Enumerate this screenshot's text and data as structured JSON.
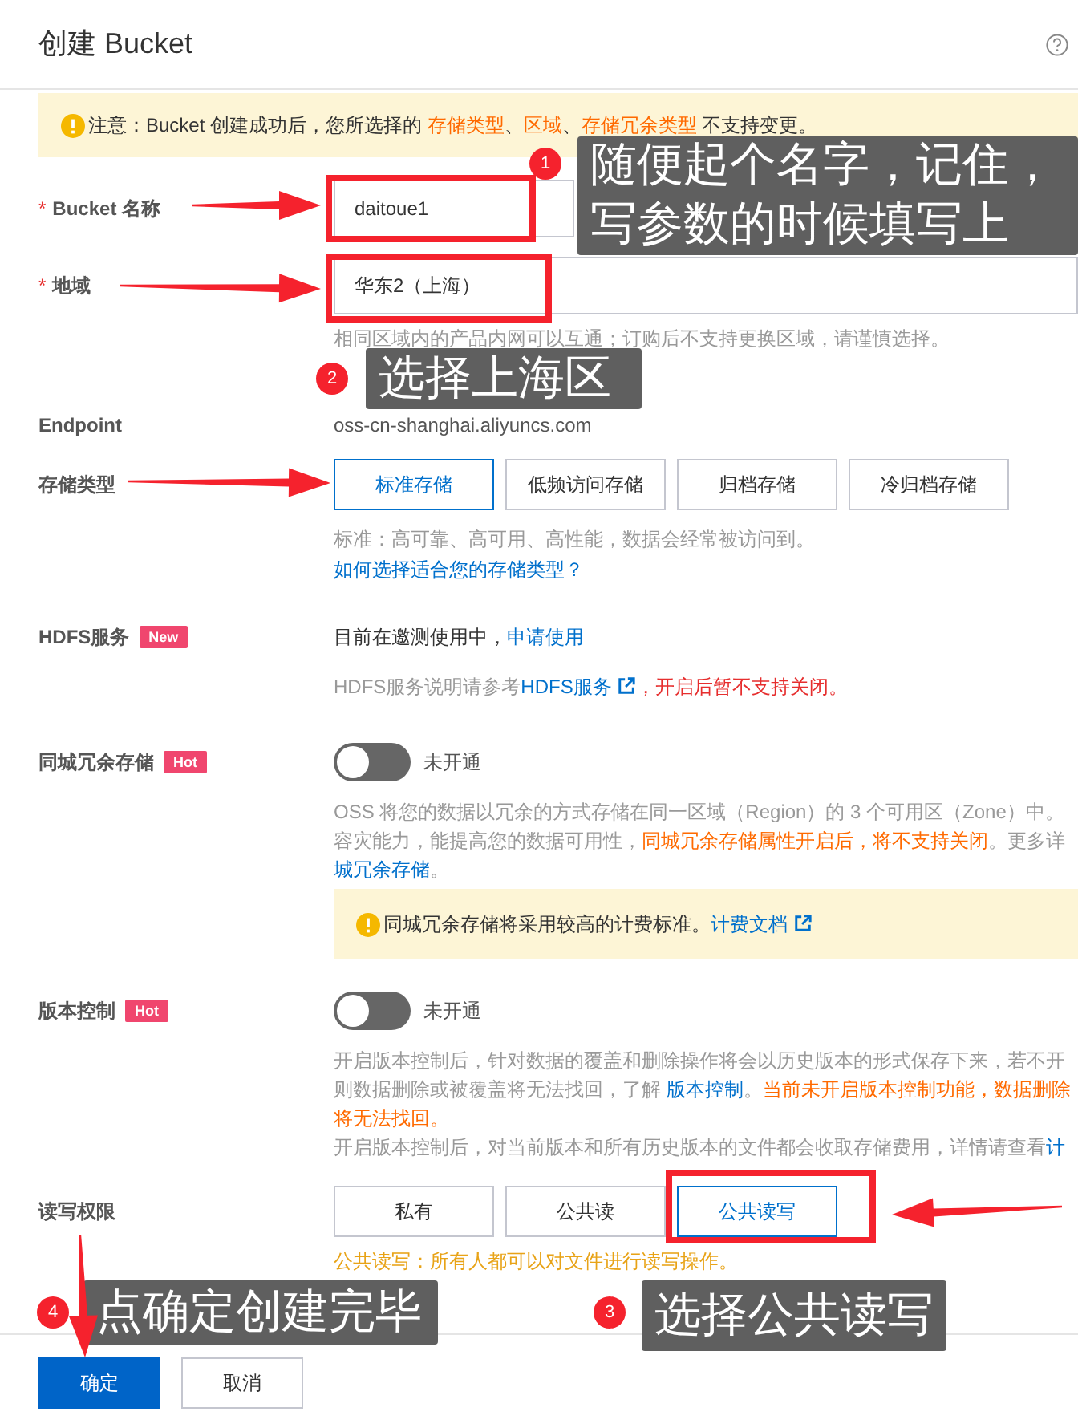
{
  "header": {
    "title": "创建 Bucket"
  },
  "notice": {
    "segments": [
      {
        "text": "注意：Bucket 创建成功后，您所选择的 ",
        "kind": "plain"
      },
      {
        "text": "存储类型",
        "kind": "warn"
      },
      {
        "text": "、",
        "kind": "plain"
      },
      {
        "text": "区域",
        "kind": "warn"
      },
      {
        "text": "、",
        "kind": "plain"
      },
      {
        "text": "存储冗余类型",
        "kind": "warn"
      },
      {
        "text": " 不支持变更。",
        "kind": "plain"
      }
    ]
  },
  "bucket_name": {
    "label": "Bucket 名称",
    "required_mark": "*",
    "value": "daitoue1"
  },
  "region": {
    "label": "地域",
    "required_mark": "*",
    "value": "华东2（上海）",
    "hint": "相同区域内的产品内网可以互通；订购后不支持更换区域，请谨慎选择。"
  },
  "endpoint": {
    "label": "Endpoint",
    "value": "oss-cn-shanghai.aliyuncs.com"
  },
  "storage_class": {
    "label": "存储类型",
    "options": [
      {
        "label": "标准存储",
        "selected": true
      },
      {
        "label": "低频访问存储",
        "selected": false
      },
      {
        "label": "归档存储",
        "selected": false
      },
      {
        "label": "冷归档存储",
        "selected": false
      }
    ],
    "hint": "标准：高可靠、高可用、高性能，数据会经常被访问到。",
    "link": "如何选择适合您的存储类型？"
  },
  "hdfs": {
    "label": "HDFS服务",
    "badge": "New",
    "lines": [
      [
        {
          "text": "目前在邀测使用中，",
          "kind": "plain"
        },
        {
          "text": "申请使用",
          "kind": "link"
        }
      ],
      [
        {
          "text": "HDFS服务说明请参考",
          "kind": "muted"
        },
        {
          "text": "HDFS服务",
          "kind": "extlink"
        },
        {
          "text": "，开启后暂不支持关闭。",
          "kind": "danger"
        }
      ]
    ]
  },
  "redundancy": {
    "label": "同城冗余存储",
    "badge": "Hot",
    "on": false,
    "state_text": "未开通",
    "lines": [
      [
        {
          "text": "OSS 将您的数据以冗余的方式存储在同一区域（Region）的 3 个可用区（Zone）中。",
          "kind": "muted"
        }
      ],
      [
        {
          "text": "容灾能力，能提高您的数据可用性，",
          "kind": "muted"
        },
        {
          "text": "同城冗余存储属性开启后，将不支持关闭",
          "kind": "warn"
        },
        {
          "text": "。更多详",
          "kind": "muted"
        }
      ],
      [
        {
          "text": "城冗余存储",
          "kind": "link"
        },
        {
          "text": "。",
          "kind": "muted"
        }
      ]
    ],
    "warning": [
      {
        "text": "同城冗余存储将采用较高的计费标准。",
        "kind": "plain"
      },
      {
        "text": "计费文档",
        "kind": "extlink"
      }
    ]
  },
  "versioning": {
    "label": "版本控制",
    "badge": "Hot",
    "on": false,
    "state_text": "未开通",
    "lines": [
      [
        {
          "text": "开启版本控制后，针对数据的覆盖和删除操作将会以历史版本的形式保存下来，若不开",
          "kind": "muted"
        }
      ],
      [
        {
          "text": "则数据删除或被覆盖将无法找回，了解 ",
          "kind": "muted"
        },
        {
          "text": "版本控制",
          "kind": "link"
        },
        {
          "text": "。",
          "kind": "muted"
        },
        {
          "text": "当前未开启版本控制功能，数据删除",
          "kind": "warn"
        }
      ],
      [
        {
          "text": "将无法找回。",
          "kind": "warn"
        }
      ],
      [
        {
          "text": "开启版本控制后，对当前版本和所有历史版本的文件都会收取存储费用，详情请查看",
          "kind": "muted"
        },
        {
          "text": "计",
          "kind": "link"
        }
      ]
    ]
  },
  "acl": {
    "label": "读写权限",
    "options": [
      {
        "label": "私有",
        "selected": false
      },
      {
        "label": "公共读",
        "selected": false
      },
      {
        "label": "公共读写",
        "selected": true
      }
    ],
    "hint": "公共读写：所有人都可以对文件进行读写操作。"
  },
  "buttons": [
    {
      "label": "确定",
      "kind": "primary"
    },
    {
      "label": "取消",
      "kind": "secondary"
    }
  ],
  "annotations": [
    {
      "number": "1",
      "text": "随便起个名字，记住，写参数的时候填写上"
    },
    {
      "number": "2",
      "text": "选择上海区"
    },
    {
      "number": "4",
      "text": "点确定创建完毕"
    },
    {
      "number": "3",
      "text": "选择公共读写"
    }
  ]
}
